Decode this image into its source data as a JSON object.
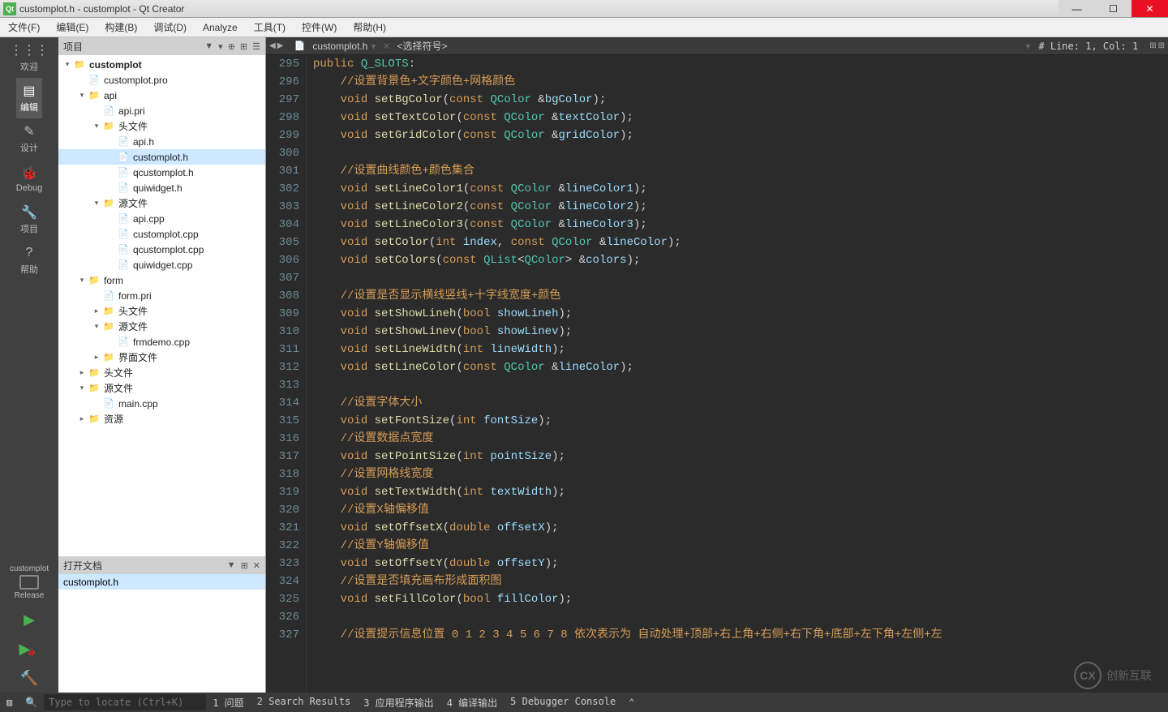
{
  "window": {
    "title": "customplot.h - customplot - Qt Creator",
    "app_icon_text": "Qt"
  },
  "menu": [
    "文件(F)",
    "编辑(E)",
    "构建(B)",
    "调试(D)",
    "Analyze",
    "工具(T)",
    "控件(W)",
    "帮助(H)"
  ],
  "modes": [
    {
      "icon": "⋮⋮⋮",
      "label": "欢迎"
    },
    {
      "icon": "▤",
      "label": "编辑",
      "active": true
    },
    {
      "icon": "✎",
      "label": "设计"
    },
    {
      "icon": "🐞",
      "label": "Debug"
    },
    {
      "icon": "🔧",
      "label": "项目"
    },
    {
      "icon": "?",
      "label": "帮助"
    }
  ],
  "kit": {
    "name": "customplot",
    "build": "Release"
  },
  "run_buttons": [
    {
      "icon": "▶",
      "color": "#4caf50"
    },
    {
      "icon": "▶",
      "color": "#4caf50",
      "bug": true
    },
    {
      "icon": "🔨",
      "color": "#e07020"
    }
  ],
  "project_panel": {
    "title": "项目",
    "header_icons": [
      "▼",
      "▾",
      "⊕",
      "⊞",
      "☰"
    ]
  },
  "tree": [
    {
      "depth": 0,
      "arrow": "▾",
      "icon": "folder",
      "label": "customplot",
      "bold": true
    },
    {
      "depth": 1,
      "arrow": "",
      "icon": "file-pro",
      "label": "customplot.pro"
    },
    {
      "depth": 1,
      "arrow": "▾",
      "icon": "folder",
      "label": "api"
    },
    {
      "depth": 2,
      "arrow": "",
      "icon": "file-pro",
      "label": "api.pri"
    },
    {
      "depth": 2,
      "arrow": "▾",
      "icon": "folder",
      "label": "头文件"
    },
    {
      "depth": 3,
      "arrow": "",
      "icon": "file-h",
      "label": "api.h"
    },
    {
      "depth": 3,
      "arrow": "",
      "icon": "file-h",
      "label": "customplot.h",
      "selected": true
    },
    {
      "depth": 3,
      "arrow": "",
      "icon": "file-h",
      "label": "qcustomplot.h"
    },
    {
      "depth": 3,
      "arrow": "",
      "icon": "file-h",
      "label": "quiwidget.h"
    },
    {
      "depth": 2,
      "arrow": "▾",
      "icon": "folder",
      "label": "源文件"
    },
    {
      "depth": 3,
      "arrow": "",
      "icon": "file-cpp",
      "label": "api.cpp"
    },
    {
      "depth": 3,
      "arrow": "",
      "icon": "file-cpp",
      "label": "customplot.cpp"
    },
    {
      "depth": 3,
      "arrow": "",
      "icon": "file-cpp",
      "label": "qcustomplot.cpp"
    },
    {
      "depth": 3,
      "arrow": "",
      "icon": "file-cpp",
      "label": "quiwidget.cpp"
    },
    {
      "depth": 1,
      "arrow": "▾",
      "icon": "folder",
      "label": "form"
    },
    {
      "depth": 2,
      "arrow": "",
      "icon": "file-pro",
      "label": "form.pri"
    },
    {
      "depth": 2,
      "arrow": "▸",
      "icon": "folder",
      "label": "头文件"
    },
    {
      "depth": 2,
      "arrow": "▾",
      "icon": "folder",
      "label": "源文件"
    },
    {
      "depth": 3,
      "arrow": "",
      "icon": "file-cpp",
      "label": "frmdemo.cpp"
    },
    {
      "depth": 2,
      "arrow": "▸",
      "icon": "folder",
      "label": "界面文件"
    },
    {
      "depth": 1,
      "arrow": "▸",
      "icon": "folder",
      "label": "头文件"
    },
    {
      "depth": 1,
      "arrow": "▾",
      "icon": "folder",
      "label": "源文件"
    },
    {
      "depth": 2,
      "arrow": "",
      "icon": "file-cpp",
      "label": "main.cpp"
    },
    {
      "depth": 1,
      "arrow": "▸",
      "icon": "folder",
      "label": "资源"
    }
  ],
  "open_docs": {
    "title": "打开文档",
    "header_icons": [
      "▼",
      "⊞",
      "✕"
    ],
    "items": [
      "customplot.h"
    ]
  },
  "editor_tab": {
    "nav": [
      "◀",
      "▶"
    ],
    "file_icon": "h",
    "file": "customplot.h",
    "symbol": "<选择符号>",
    "line_col": "#  Line: 1, Col: 1",
    "split_icons": [
      "⊞",
      "⊞"
    ]
  },
  "code_lines": [
    {
      "n": 295,
      "html": "<span class='kw'>public</span> <span class='cls'>Q_SLOTS</span><span class='punc'>:</span>"
    },
    {
      "n": 296,
      "html": "    <span class='comment'>//设置背景色+文字颜色+网格颜色</span>"
    },
    {
      "n": 297,
      "html": "    <span class='kw'>void</span> <span class='fn'>setBgColor</span><span class='punc'>(</span><span class='kw'>const</span> <span class='cls'>QColor</span> <span class='punc'>&amp;</span><span class='ident'>bgColor</span><span class='punc'>);</span>"
    },
    {
      "n": 298,
      "html": "    <span class='kw'>void</span> <span class='fn'>setTextColor</span><span class='punc'>(</span><span class='kw'>const</span> <span class='cls'>QColor</span> <span class='punc'>&amp;</span><span class='ident'>textColor</span><span class='punc'>);</span>"
    },
    {
      "n": 299,
      "html": "    <span class='kw'>void</span> <span class='fn'>setGridColor</span><span class='punc'>(</span><span class='kw'>const</span> <span class='cls'>QColor</span> <span class='punc'>&amp;</span><span class='ident'>gridColor</span><span class='punc'>);</span>"
    },
    {
      "n": 300,
      "html": ""
    },
    {
      "n": 301,
      "html": "    <span class='comment'>//设置曲线颜色+颜色集合</span>"
    },
    {
      "n": 302,
      "html": "    <span class='kw'>void</span> <span class='fn'>setLineColor1</span><span class='punc'>(</span><span class='kw'>const</span> <span class='cls'>QColor</span> <span class='punc'>&amp;</span><span class='ident'>lineColor1</span><span class='punc'>);</span>"
    },
    {
      "n": 303,
      "html": "    <span class='kw'>void</span> <span class='fn'>setLineColor2</span><span class='punc'>(</span><span class='kw'>const</span> <span class='cls'>QColor</span> <span class='punc'>&amp;</span><span class='ident'>lineColor2</span><span class='punc'>);</span>"
    },
    {
      "n": 304,
      "html": "    <span class='kw'>void</span> <span class='fn'>setLineColor3</span><span class='punc'>(</span><span class='kw'>const</span> <span class='cls'>QColor</span> <span class='punc'>&amp;</span><span class='ident'>lineColor3</span><span class='punc'>);</span>"
    },
    {
      "n": 305,
      "html": "    <span class='kw'>void</span> <span class='fn'>setColor</span><span class='punc'>(</span><span class='kw'>int</span> <span class='ident'>index</span><span class='punc'>,</span> <span class='kw'>const</span> <span class='cls'>QColor</span> <span class='punc'>&amp;</span><span class='ident'>lineColor</span><span class='punc'>);</span>"
    },
    {
      "n": 306,
      "html": "    <span class='kw'>void</span> <span class='fn'>setColors</span><span class='punc'>(</span><span class='kw'>const</span> <span class='cls'>QList</span><span class='punc'>&lt;</span><span class='cls'>QColor</span><span class='punc'>&gt; &amp;</span><span class='ident'>colors</span><span class='punc'>);</span>"
    },
    {
      "n": 307,
      "html": ""
    },
    {
      "n": 308,
      "html": "    <span class='comment'>//设置是否显示横线竖线+十字线宽度+颜色</span>"
    },
    {
      "n": 309,
      "html": "    <span class='kw'>void</span> <span class='fn'>setShowLineh</span><span class='punc'>(</span><span class='kw'>bool</span> <span class='ident'>showLineh</span><span class='punc'>);</span>"
    },
    {
      "n": 310,
      "html": "    <span class='kw'>void</span> <span class='fn'>setShowLinev</span><span class='punc'>(</span><span class='kw'>bool</span> <span class='ident'>showLinev</span><span class='punc'>);</span>"
    },
    {
      "n": 311,
      "html": "    <span class='kw'>void</span> <span class='fn'>setLineWidth</span><span class='punc'>(</span><span class='kw'>int</span> <span class='ident'>lineWidth</span><span class='punc'>);</span>"
    },
    {
      "n": 312,
      "html": "    <span class='kw'>void</span> <span class='fn'>setLineColor</span><span class='punc'>(</span><span class='kw'>const</span> <span class='cls'>QColor</span> <span class='punc'>&amp;</span><span class='ident'>lineColor</span><span class='punc'>);</span>"
    },
    {
      "n": 313,
      "html": ""
    },
    {
      "n": 314,
      "html": "    <span class='comment'>//设置字体大小</span>"
    },
    {
      "n": 315,
      "html": "    <span class='kw'>void</span> <span class='fn'>setFontSize</span><span class='punc'>(</span><span class='kw'>int</span> <span class='ident'>fontSize</span><span class='punc'>);</span>"
    },
    {
      "n": 316,
      "html": "    <span class='comment'>//设置数据点宽度</span>"
    },
    {
      "n": 317,
      "html": "    <span class='kw'>void</span> <span class='fn'>setPointSize</span><span class='punc'>(</span><span class='kw'>int</span> <span class='ident'>pointSize</span><span class='punc'>);</span>"
    },
    {
      "n": 318,
      "html": "    <span class='comment'>//设置网格线宽度</span>"
    },
    {
      "n": 319,
      "html": "    <span class='kw'>void</span> <span class='fn'>setTextWidth</span><span class='punc'>(</span><span class='kw'>int</span> <span class='ident'>textWidth</span><span class='punc'>);</span>"
    },
    {
      "n": 320,
      "html": "    <span class='comment'>//设置X轴偏移值</span>"
    },
    {
      "n": 321,
      "html": "    <span class='kw'>void</span> <span class='fn'>setOffsetX</span><span class='punc'>(</span><span class='kw'>double</span> <span class='ident'>offsetX</span><span class='punc'>);</span>"
    },
    {
      "n": 322,
      "html": "    <span class='comment'>//设置Y轴偏移值</span>"
    },
    {
      "n": 323,
      "html": "    <span class='kw'>void</span> <span class='fn'>setOffsetY</span><span class='punc'>(</span><span class='kw'>double</span> <span class='ident'>offsetY</span><span class='punc'>);</span>"
    },
    {
      "n": 324,
      "html": "    <span class='comment'>//设置是否填充画布形成面积图</span>"
    },
    {
      "n": 325,
      "html": "    <span class='kw'>void</span> <span class='fn'>setFillColor</span><span class='punc'>(</span><span class='kw'>bool</span> <span class='ident'>fillColor</span><span class='punc'>);</span>"
    },
    {
      "n": 326,
      "html": ""
    },
    {
      "n": 327,
      "html": "    <span class='comment'>//设置提示信息位置 0 1 2 3 4 5 6 7 8 依次表示为 自动处理+顶部+右上角+右侧+右下角+底部+左下角+左侧+左</span>"
    }
  ],
  "status": {
    "locate_placeholder": "Type to locate (Ctrl+K)",
    "panes": [
      "1 问题",
      "2 Search Results",
      "3 应用程序输出",
      "4 编译输出",
      "5 Debugger Console"
    ],
    "arrow": "⌃"
  },
  "watermark": {
    "logo": "CX",
    "text": "创新互联"
  }
}
